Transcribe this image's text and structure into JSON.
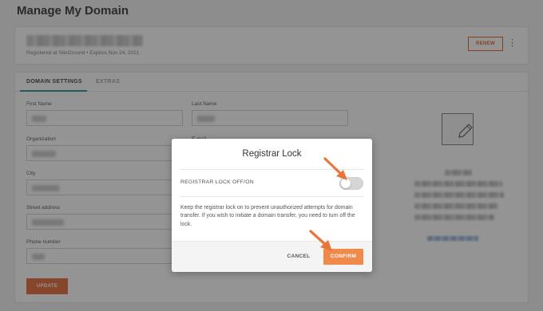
{
  "page": {
    "title": "Manage My Domain"
  },
  "domain_card": {
    "registration_line": "Registered at SiteGround  •  Expires Nov 24, 2021",
    "renew_label": "RENEW",
    "more_icon": "kebab-icon"
  },
  "tabs": [
    {
      "label": "DOMAIN SETTINGS",
      "active": true
    },
    {
      "label": "EXTRAS",
      "active": false
    }
  ],
  "form": {
    "first_name_label": "First Name",
    "last_name_label": "Last Name",
    "organization_label": "Organization",
    "email_label": "E-mail",
    "city_label": "City",
    "street_label": "Street address",
    "phone_label": "Phone number",
    "update_label": "UPDATE"
  },
  "side_panel": {
    "icon": "edit-document-icon"
  },
  "modal": {
    "title": "Registrar Lock",
    "toggle_label": "REGISTRAR LOCK OFF/ON",
    "toggle_state": "off",
    "description": "Keep the registrar lock on to prevent unauthorized attempts for domain transfer. If you wish to initiate a domain transfer, you need to turn off the lock.",
    "cancel_label": "CANCEL",
    "confirm_label": "CONFIRM"
  },
  "colors": {
    "accent": "#f08a4b",
    "tab_underline": "#3d9fa0",
    "annotation_arrow": "#e8763a"
  }
}
